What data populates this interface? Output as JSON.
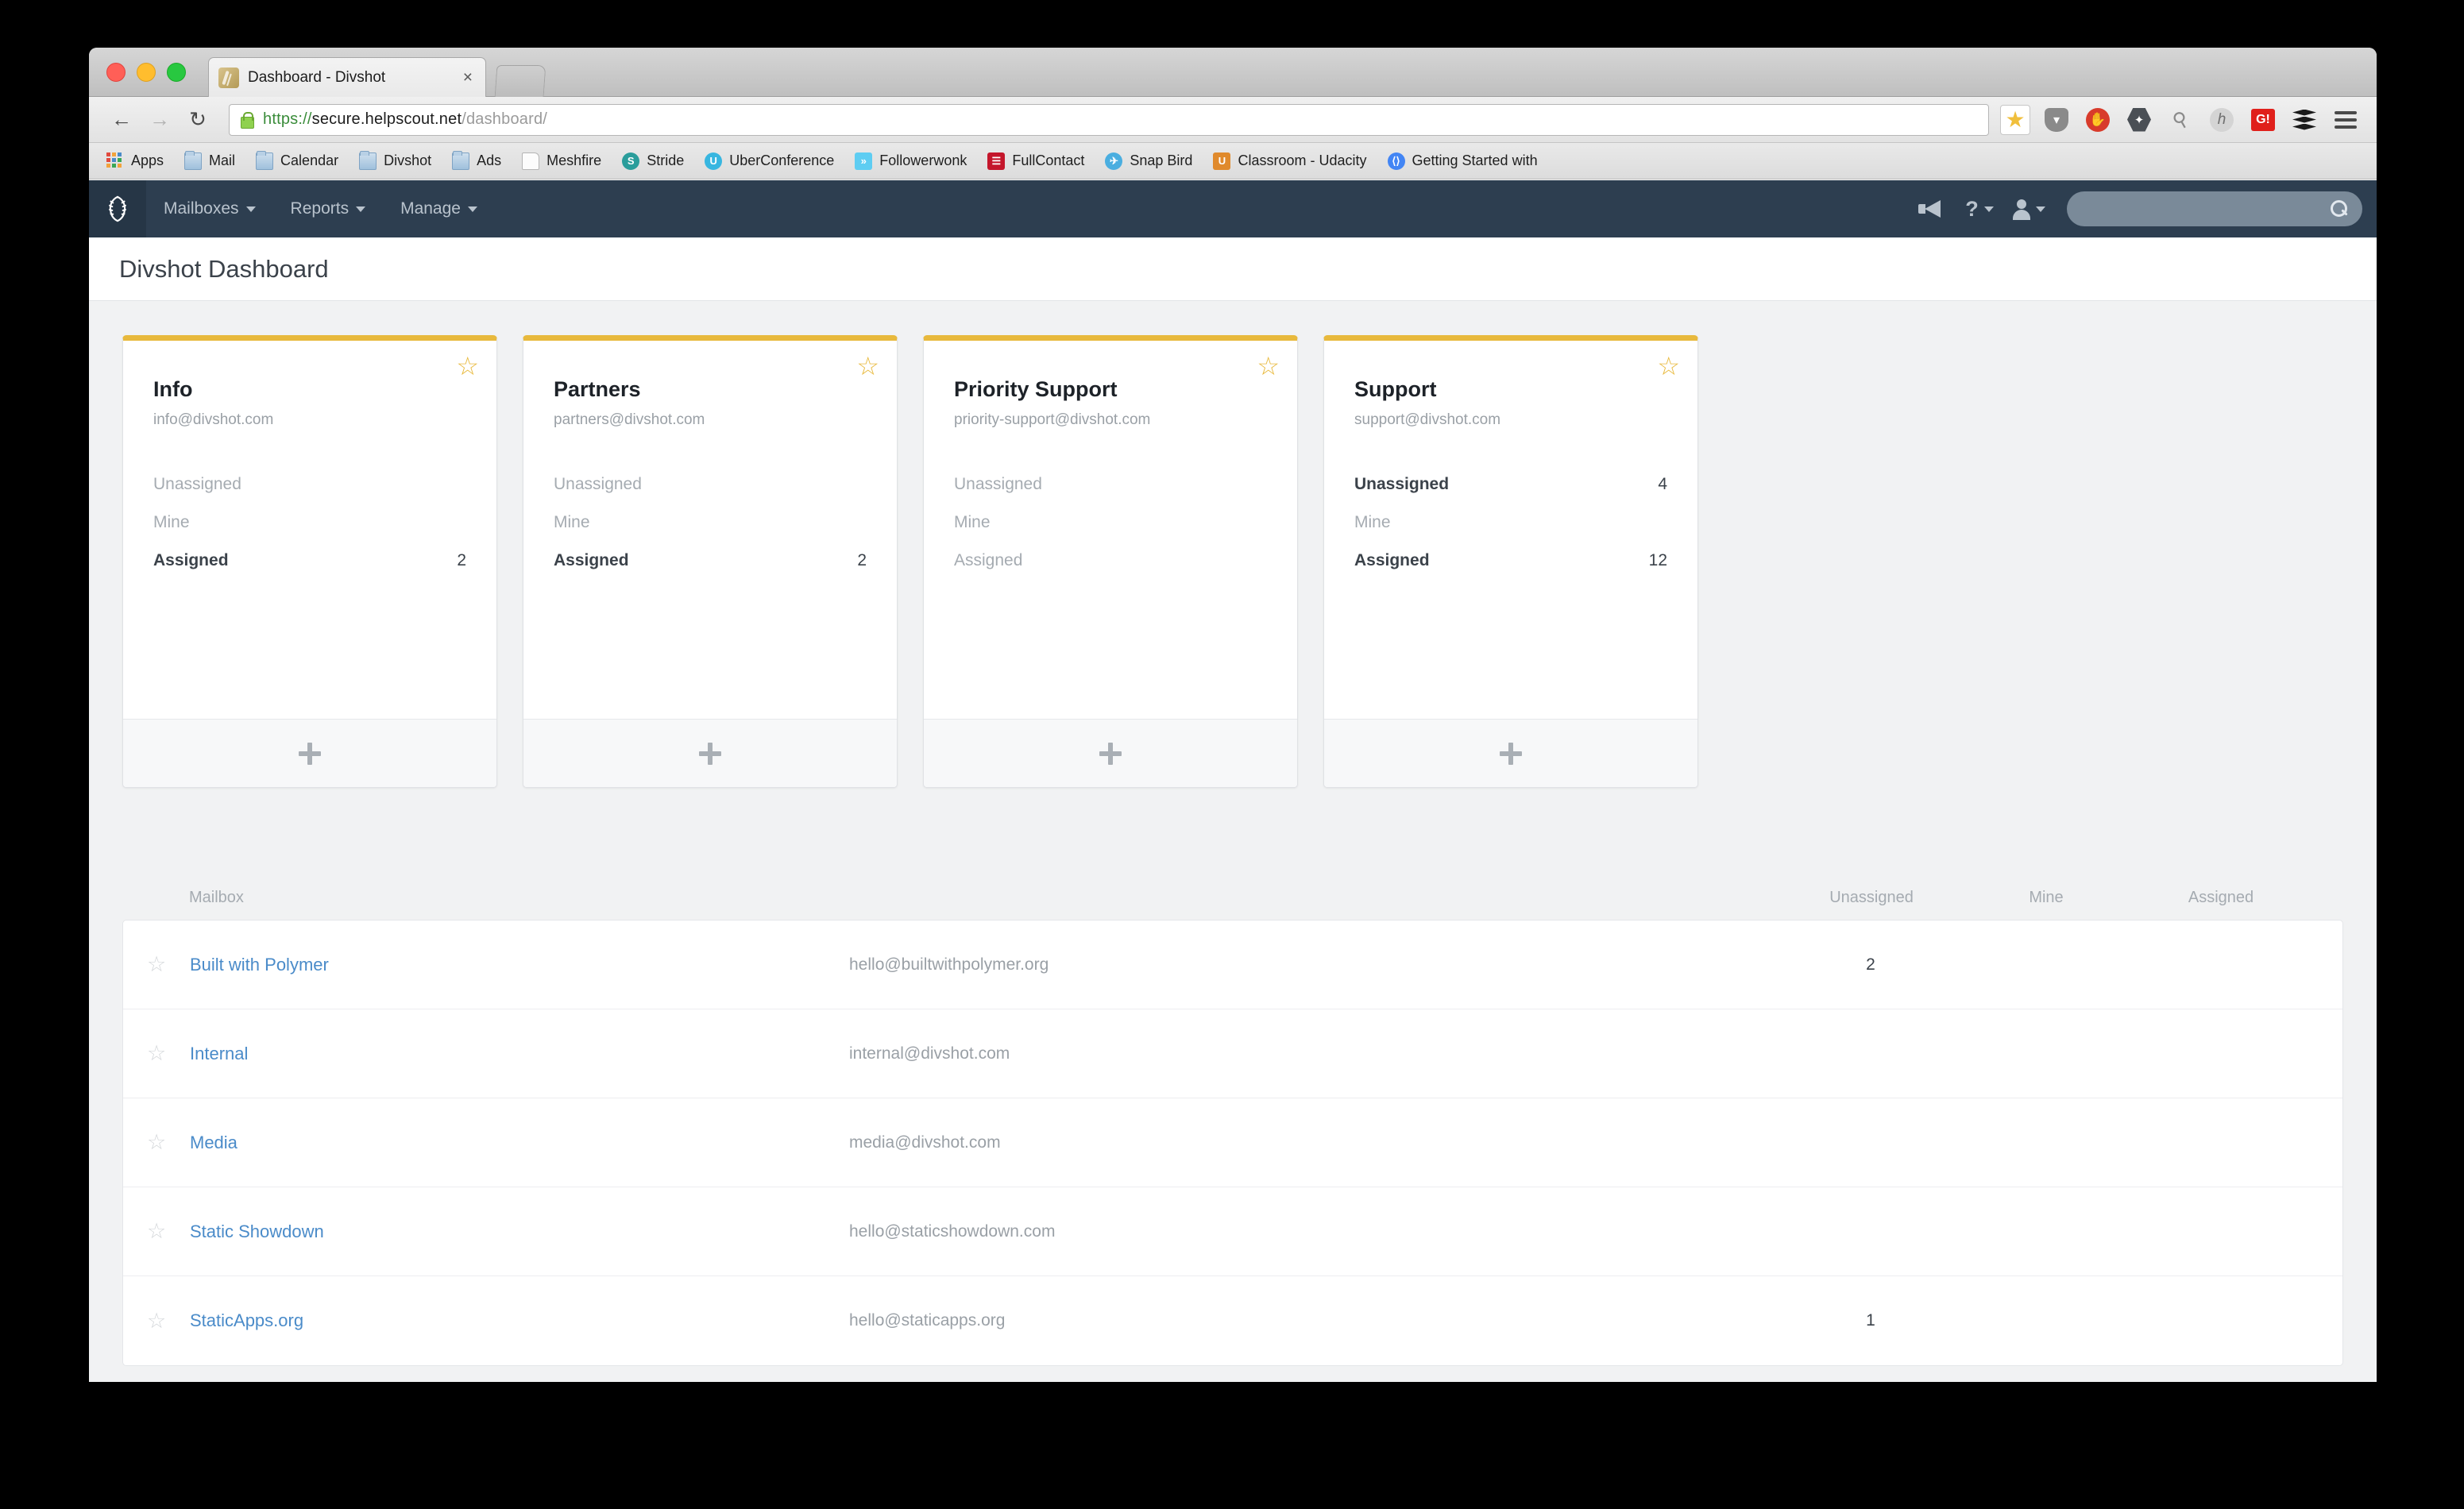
{
  "browser": {
    "tab_title": "Dashboard - Divshot",
    "tab_close_label": "×",
    "url": {
      "scheme": "https://",
      "host": "secure.helpscout.net",
      "path": "/dashboard/"
    },
    "nav": {
      "back": "←",
      "forward": "→",
      "reload": "↻"
    },
    "toolbar_icons": [
      {
        "name": "bookmark-star-icon",
        "glyph": "★"
      },
      {
        "name": "pocket-icon",
        "glyph": "▾"
      },
      {
        "name": "adblock-icon",
        "glyph": "✋"
      },
      {
        "name": "lastpass-icon",
        "glyph": "✦"
      },
      {
        "name": "key-icon",
        "glyph": "⚷"
      },
      {
        "name": "hover-icon",
        "glyph": "h"
      },
      {
        "name": "grammarly-icon",
        "glyph": "G!"
      },
      {
        "name": "buffer-icon",
        "glyph": ""
      },
      {
        "name": "browser-menu-icon",
        "glyph": ""
      }
    ],
    "bookmarks": [
      {
        "label": "Apps",
        "icon": "apps-grid-icon",
        "type": "apps"
      },
      {
        "label": "Mail",
        "icon": "folder-icon",
        "type": "folder"
      },
      {
        "label": "Calendar",
        "icon": "folder-icon",
        "type": "folder"
      },
      {
        "label": "Divshot",
        "icon": "folder-icon",
        "type": "folder"
      },
      {
        "label": "Ads",
        "icon": "folder-icon",
        "type": "folder"
      },
      {
        "label": "Meshfire",
        "icon": "page-icon",
        "type": "page"
      },
      {
        "label": "Stride",
        "icon": "stride-icon",
        "type": "circle",
        "color": "#2a9d9b",
        "glyph": "S"
      },
      {
        "label": "UberConference",
        "icon": "uberconference-icon",
        "type": "circle",
        "color": "#38b6e0",
        "glyph": "U"
      },
      {
        "label": "Followerwonk",
        "icon": "followerwonk-icon",
        "type": "square",
        "color": "#5ecdf2",
        "glyph": "»"
      },
      {
        "label": "FullContact",
        "icon": "fullcontact-icon",
        "type": "square",
        "color": "#c4162b",
        "glyph": "☰"
      },
      {
        "label": "Snap Bird",
        "icon": "snapbird-icon",
        "type": "circle",
        "color": "#4aaee0",
        "glyph": "✈"
      },
      {
        "label": "Classroom - Udacity",
        "icon": "udacity-icon",
        "type": "square",
        "color": "#e08a2c",
        "glyph": "U"
      },
      {
        "label": "Getting Started with",
        "icon": "google-icon",
        "type": "circle",
        "color": "#4285f4",
        "glyph": "⟨⟩"
      }
    ]
  },
  "app": {
    "logo_name": "helpscout-logo",
    "nav_items": [
      {
        "label": "Mailboxes",
        "name": "nav-mailboxes"
      },
      {
        "label": "Reports",
        "name": "nav-reports"
      },
      {
        "label": "Manage",
        "name": "nav-manage"
      }
    ],
    "nav_right": {
      "announcements_name": "megaphone-icon",
      "help_label": "?",
      "account_name": "user-avatar-icon",
      "search_placeholder": "",
      "search_value": ""
    },
    "page_title": "Divshot Dashboard"
  },
  "cards": [
    {
      "title": "Info",
      "email": "info@divshot.com",
      "starred": true,
      "stats": [
        {
          "label": "Unassigned",
          "value": "",
          "filled": false
        },
        {
          "label": "Mine",
          "value": "",
          "filled": false
        },
        {
          "label": "Assigned",
          "value": "2",
          "filled": true
        }
      ],
      "add_label": "+"
    },
    {
      "title": "Partners",
      "email": "partners@divshot.com",
      "starred": true,
      "stats": [
        {
          "label": "Unassigned",
          "value": "",
          "filled": false
        },
        {
          "label": "Mine",
          "value": "",
          "filled": false
        },
        {
          "label": "Assigned",
          "value": "2",
          "filled": true
        }
      ],
      "add_label": "+"
    },
    {
      "title": "Priority Support",
      "email": "priority-support@divshot.com",
      "starred": true,
      "stats": [
        {
          "label": "Unassigned",
          "value": "",
          "filled": false
        },
        {
          "label": "Mine",
          "value": "",
          "filled": false
        },
        {
          "label": "Assigned",
          "value": "",
          "filled": false
        }
      ],
      "add_label": "+"
    },
    {
      "title": "Support",
      "email": "support@divshot.com",
      "starred": true,
      "stats": [
        {
          "label": "Unassigned",
          "value": "4",
          "filled": true
        },
        {
          "label": "Mine",
          "value": "",
          "filled": false
        },
        {
          "label": "Assigned",
          "value": "12",
          "filled": true
        }
      ],
      "add_label": "+"
    }
  ],
  "table": {
    "headers": {
      "mailbox": "Mailbox",
      "unassigned": "Unassigned",
      "mine": "Mine",
      "assigned": "Assigned"
    },
    "rows": [
      {
        "name": "Built with Polymer",
        "email": "hello@builtwithpolymer.org",
        "unassigned": "2",
        "mine": "",
        "assigned": "",
        "starred": false
      },
      {
        "name": "Internal",
        "email": "internal@divshot.com",
        "unassigned": "",
        "mine": "",
        "assigned": "",
        "starred": false
      },
      {
        "name": "Media",
        "email": "media@divshot.com",
        "unassigned": "",
        "mine": "",
        "assigned": "",
        "starred": false
      },
      {
        "name": "Static Showdown",
        "email": "hello@staticshowdown.com",
        "unassigned": "",
        "mine": "",
        "assigned": "",
        "starred": false
      },
      {
        "name": "StaticApps.org",
        "email": "hello@staticapps.org",
        "unassigned": "1",
        "mine": "",
        "assigned": "",
        "starred": false
      }
    ]
  },
  "colors": {
    "accent_gold": "#e8b93c",
    "nav_dark": "#2d3e50",
    "link_blue": "#4a8bc9",
    "page_bg": "#f1f2f3"
  }
}
